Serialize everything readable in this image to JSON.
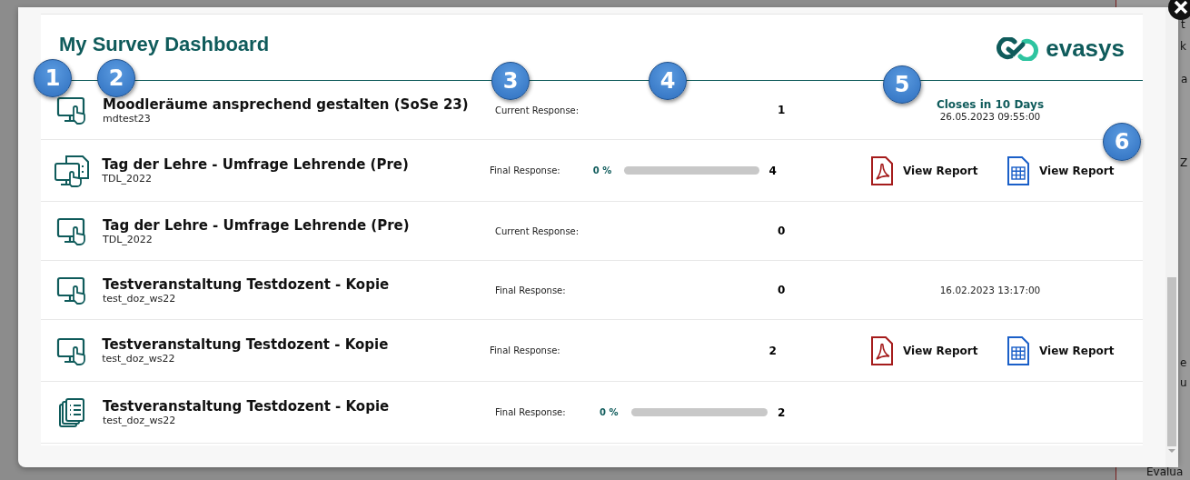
{
  "background_fragments": [
    "t",
    "k",
    "a",
    "Z",
    "e",
    "u",
    "Evalua"
  ],
  "dialog": {
    "title": "My Survey Dashboard",
    "logo": "evasys"
  },
  "callouts": [
    "1",
    "2",
    "3",
    "4",
    "5",
    "6"
  ],
  "surveys": [
    {
      "kind": "monitor",
      "title": "Moodleräume ansprechend gestalten (SoSe 23)",
      "code": "mdtest23",
      "response_label": "Current Response:",
      "count": "1",
      "closing": {
        "status": "Closes in 10 Days",
        "date": "26.05.2023 09:55:00"
      }
    },
    {
      "kind": "monitor_doc",
      "title": "Tag der Lehre - Umfrage Lehrende (Pre)",
      "code": "TDL_2022",
      "response_label": "Final Response:",
      "percent": "0 %",
      "level": 0,
      "count": "4",
      "reports": [
        {
          "kind": "pdf",
          "label": "View Report"
        },
        {
          "kind": "table",
          "label": "View Report"
        }
      ]
    },
    {
      "kind": "monitor",
      "title": "Tag der Lehre - Umfrage Lehrende (Pre)",
      "code": "TDL_2022",
      "response_label": "Current Response:",
      "count": "0"
    },
    {
      "kind": "monitor",
      "title": "Testveranstaltung Testdozent - Kopie",
      "code": "test_doz_ws22",
      "response_label": "Final Response:",
      "count": "0",
      "closing": {
        "date": "16.02.2023 13:17:00"
      }
    },
    {
      "kind": "monitor",
      "title": "Testveranstaltung Testdozent - Kopie",
      "code": "test_doz_ws22",
      "response_label": "Final Response:",
      "count": "2",
      "reports": [
        {
          "kind": "pdf",
          "label": "View Report"
        },
        {
          "kind": "table",
          "label": "View Report"
        }
      ]
    },
    {
      "kind": "documents",
      "title": "Testveranstaltung Testdozent - Kopie",
      "code": "test_doz_ws22",
      "response_label": "Final Response:",
      "percent": "0 %",
      "level": 0,
      "count": "2"
    }
  ]
}
